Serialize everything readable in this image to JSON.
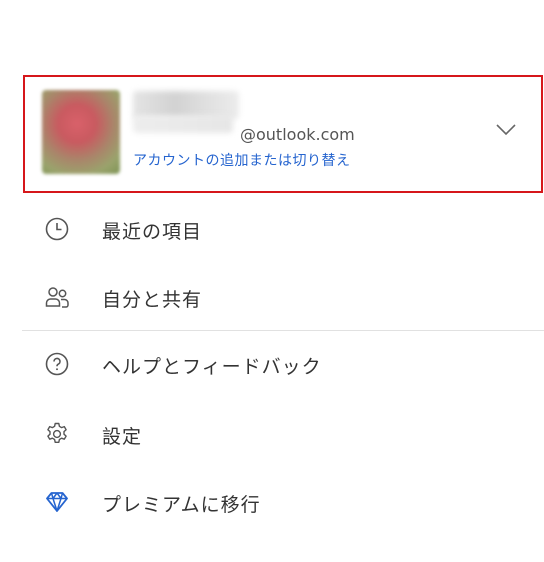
{
  "account": {
    "email_domain": "@outlook.com",
    "switch_link": "アカウントの追加または切り替え"
  },
  "menu": {
    "recent": "最近の項目",
    "shared": "自分と共有",
    "help": "ヘルプとフィードバック",
    "settings": "設定",
    "premium": "プレミアムに移行"
  },
  "colors": {
    "highlight_border": "#d6171b",
    "link": "#2564cf",
    "premium_icon": "#2564cf",
    "icon_stroke": "#555555"
  }
}
